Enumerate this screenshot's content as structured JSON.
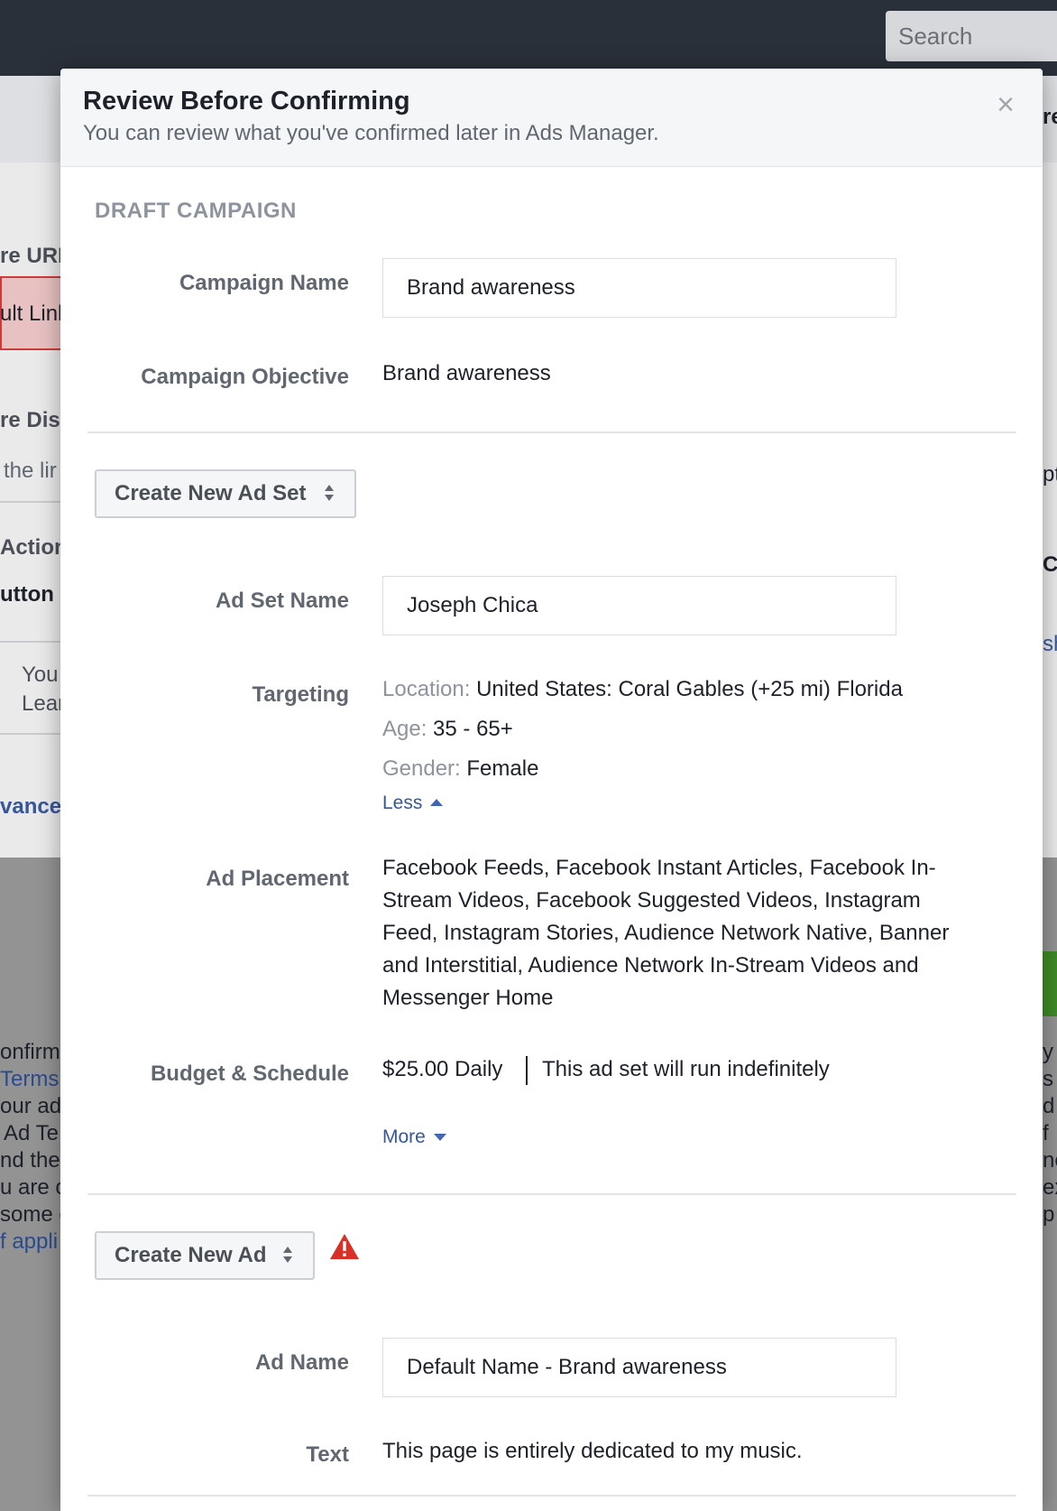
{
  "topbar": {
    "search_placeholder": "Search"
  },
  "background": {
    "snippets": [
      "re URL",
      "ult Link",
      "re Dis",
      "the lir",
      "Action",
      "utton",
      "You",
      "Lear",
      "vance",
      "onfirm'",
      "Terms",
      "our ad",
      "Ad Te",
      "nd the",
      "u are c",
      "some c",
      "f appli",
      "re",
      "pt",
      "C",
      "sh"
    ],
    "right_snippets": [
      "y",
      "s y",
      "d",
      "f",
      "ne",
      "ex",
      "p"
    ]
  },
  "modal": {
    "title": "Review Before Confirming",
    "subtitle": "You can review what you've confirmed later in Ads Manager.",
    "close_glyph": "×",
    "campaign": {
      "heading": "DRAFT CAMPAIGN",
      "name_label": "Campaign Name",
      "name_value": "Brand awareness",
      "objective_label": "Campaign Objective",
      "objective_value": "Brand awareness"
    },
    "ad_set": {
      "selector_label": "Create New Ad Set",
      "name_label": "Ad Set Name",
      "name_value": "Joseph Chica",
      "targeting_label": "Targeting",
      "location_key": "Location:",
      "location_value": "United States: Coral Gables (+25 mi) Florida",
      "age_key": "Age:",
      "age_value": "35 - 65+",
      "gender_key": "Gender:",
      "gender_value": "Female",
      "less_link": "Less",
      "placement_label": "Ad Placement",
      "placement_value": "Facebook Feeds, Facebook Instant Articles, Facebook In-Stream Videos, Facebook Suggested Videos, Instagram Feed, Instagram Stories, Audience Network Native, Banner and Interstitial, Audience Network In-Stream Videos and Messenger Home",
      "budget_label": "Budget & Schedule",
      "budget_value": "$25.00 Daily",
      "schedule_value": "This ad set will run indefinitely",
      "more_link": "More"
    },
    "ad": {
      "selector_label": "Create New Ad",
      "warning_icon": "warning-triangle-icon",
      "name_label": "Ad Name",
      "name_value": "Default Name - Brand awareness",
      "text_label": "Text",
      "text_value": "This page is entirely dedicated to my music."
    }
  },
  "colors": {
    "link": "#365899",
    "warning": "#d93025",
    "topbar": "#2a303a"
  }
}
